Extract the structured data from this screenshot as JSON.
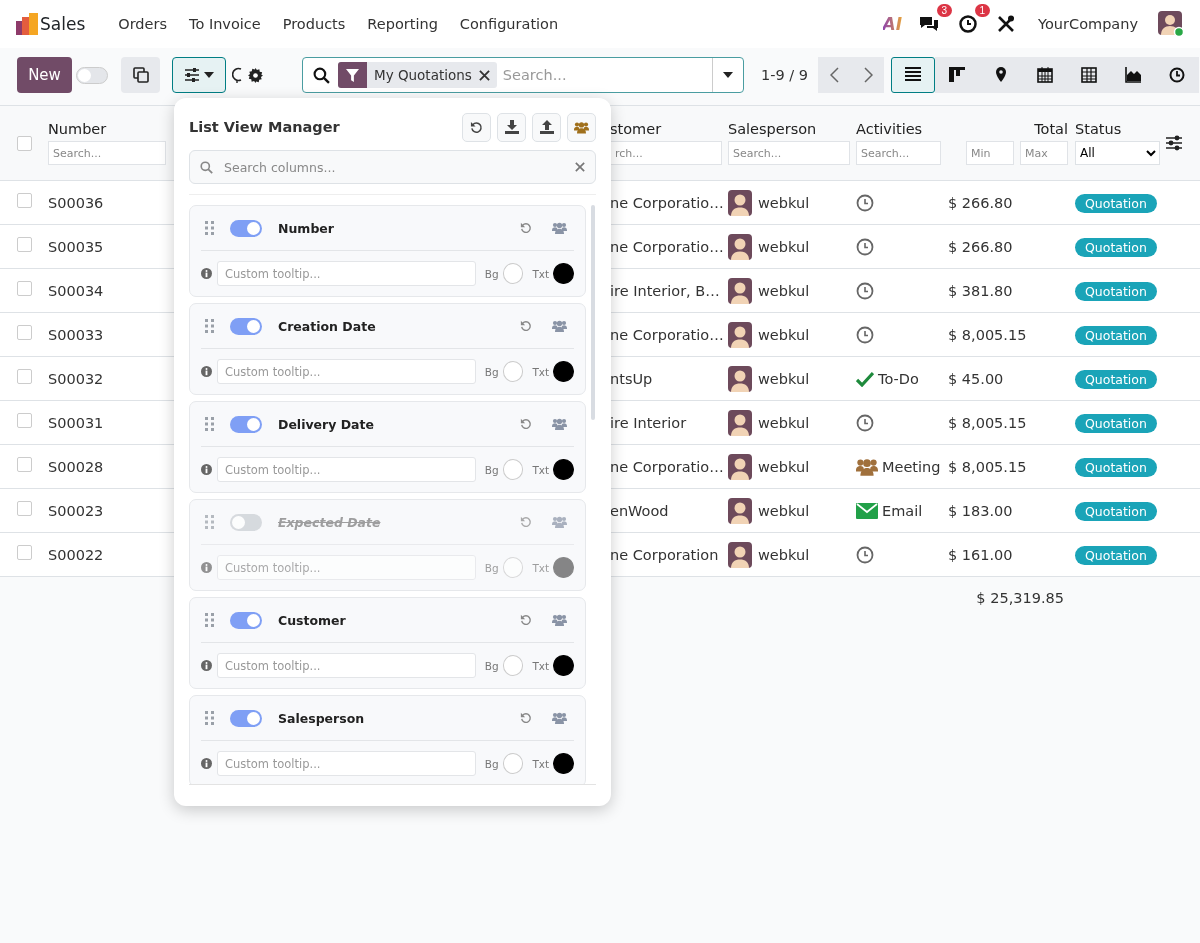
{
  "app": {
    "name": "Sales",
    "menu": [
      "Orders",
      "To Invoice",
      "Products",
      "Reporting",
      "Configuration"
    ]
  },
  "systray": {
    "ai_logo": "AI",
    "messages_badge": "3",
    "activities_badge": "1",
    "company": "YourCompany"
  },
  "toolbar": {
    "new_button": "New",
    "switch_on": false,
    "column_manager_open": true
  },
  "search": {
    "facets": [
      {
        "label": "My Quotations"
      }
    ],
    "placeholder": "Search..."
  },
  "pager": {
    "range": "1-9 / 9"
  },
  "views": [
    {
      "kind": "list",
      "selected": true
    },
    {
      "kind": "kanban",
      "selected": false
    },
    {
      "kind": "map",
      "selected": false
    },
    {
      "kind": "calendar",
      "selected": false
    },
    {
      "kind": "pivot",
      "selected": false
    },
    {
      "kind": "graph",
      "selected": false
    },
    {
      "kind": "activity",
      "selected": false
    }
  ],
  "list": {
    "all_checked": false,
    "header": {
      "number": {
        "label": "Number",
        "placeholder": "Search..."
      },
      "customer": {
        "label": "stomer",
        "placeholder": "rch..."
      },
      "salesperson": {
        "label": "Salesperson",
        "placeholder": "Search..."
      },
      "activities": {
        "label": "Activities",
        "placeholder": "Search..."
      },
      "total": {
        "label": "Total",
        "min_placeholder": "Min",
        "max_placeholder": "Max"
      },
      "status": {
        "label": "Status",
        "filter": "All"
      }
    },
    "rows": [
      {
        "checked": false,
        "number": "S00036",
        "customer": "ne Corporatio…",
        "salesperson": "webkul",
        "activity": {
          "kind": "clock"
        },
        "total": "$ 266.80",
        "status": "Quotation"
      },
      {
        "checked": false,
        "number": "S00035",
        "customer": "ne Corporatio…",
        "salesperson": "webkul",
        "activity": {
          "kind": "clock"
        },
        "total": "$ 266.80",
        "status": "Quotation"
      },
      {
        "checked": false,
        "number": "S00034",
        "customer": "ire Interior, B…",
        "salesperson": "webkul",
        "activity": {
          "kind": "clock"
        },
        "total": "$ 381.80",
        "status": "Quotation"
      },
      {
        "checked": false,
        "number": "S00033",
        "customer": "ne Corporatio…",
        "salesperson": "webkul",
        "activity": {
          "kind": "clock"
        },
        "total": "$ 8,005.15",
        "status": "Quotation"
      },
      {
        "checked": false,
        "number": "S00032",
        "customer": "ntsUp",
        "salesperson": "webkul",
        "activity": {
          "kind": "todo",
          "label": "To-Do"
        },
        "total": "$ 45.00",
        "status": "Quotation"
      },
      {
        "checked": false,
        "number": "S00031",
        "customer": "ire Interior",
        "salesperson": "webkul",
        "activity": {
          "kind": "clock"
        },
        "total": "$ 8,005.15",
        "status": "Quotation"
      },
      {
        "checked": false,
        "number": "S00028",
        "customer": "ne Corporatio…",
        "salesperson": "webkul",
        "activity": {
          "kind": "meeting",
          "label": "Meeting"
        },
        "total": "$ 8,005.15",
        "status": "Quotation"
      },
      {
        "checked": false,
        "number": "S00023",
        "customer": "enWood",
        "salesperson": "webkul",
        "activity": {
          "kind": "email",
          "label": "Email"
        },
        "total": "$ 183.00",
        "status": "Quotation"
      },
      {
        "checked": false,
        "number": "S00022",
        "customer": "ne Corporation",
        "salesperson": "webkul",
        "activity": {
          "kind": "clock"
        },
        "total": "$ 161.00",
        "status": "Quotation"
      }
    ],
    "footer_total": "$ 25,319.85"
  },
  "column_manager": {
    "title": "List View Manager",
    "search_placeholder": "Search columns...",
    "columns": [
      {
        "label": "Number",
        "visible": true,
        "tooltip_placeholder": "Custom tooltip...",
        "bg_label": "Bg",
        "txt_label": "Txt"
      },
      {
        "label": "Creation Date",
        "visible": true,
        "tooltip_placeholder": "Custom tooltip...",
        "bg_label": "Bg",
        "txt_label": "Txt"
      },
      {
        "label": "Delivery Date",
        "visible": true,
        "tooltip_placeholder": "Custom tooltip...",
        "bg_label": "Bg",
        "txt_label": "Txt"
      },
      {
        "label": "Expected Date",
        "visible": false,
        "tooltip_placeholder": "Custom tooltip...",
        "bg_label": "Bg",
        "txt_label": "Txt"
      },
      {
        "label": "Customer",
        "visible": true,
        "tooltip_placeholder": "Custom tooltip...",
        "bg_label": "Bg",
        "txt_label": "Txt"
      },
      {
        "label": "Salesperson",
        "visible": true,
        "tooltip_placeholder": "Custom tooltip...",
        "bg_label": "Bg",
        "txt_label": "Txt"
      }
    ]
  }
}
